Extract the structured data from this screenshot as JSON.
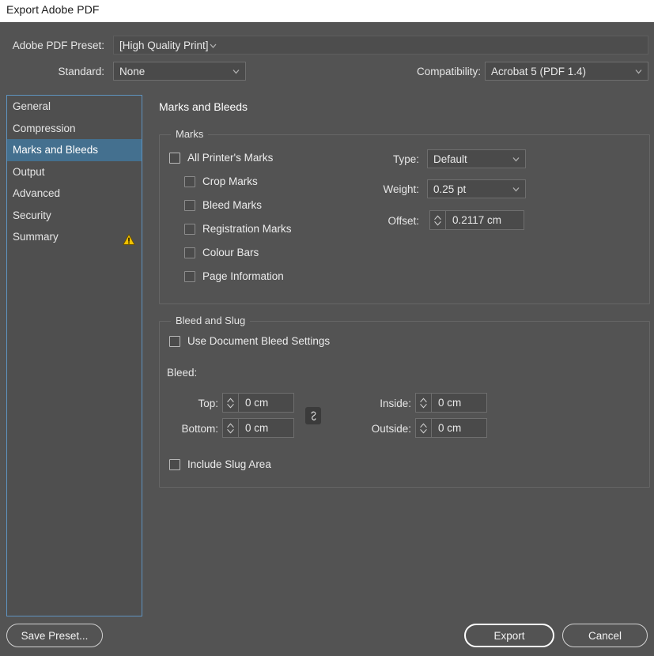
{
  "window": {
    "title": "Export Adobe PDF"
  },
  "top": {
    "preset_label": "Adobe PDF Preset:",
    "preset_value": "[High Quality Print]",
    "standard_label": "Standard:",
    "standard_value": "None",
    "compatibility_label": "Compatibility:",
    "compatibility_value": "Acrobat 5 (PDF 1.4)"
  },
  "sidebar": {
    "items": [
      {
        "label": "General",
        "selected": false,
        "warning": false
      },
      {
        "label": "Compression",
        "selected": false,
        "warning": false
      },
      {
        "label": "Marks and Bleeds",
        "selected": true,
        "warning": false
      },
      {
        "label": "Output",
        "selected": false,
        "warning": false
      },
      {
        "label": "Advanced",
        "selected": false,
        "warning": false
      },
      {
        "label": "Security",
        "selected": false,
        "warning": false
      },
      {
        "label": "Summary",
        "selected": false,
        "warning": true
      }
    ]
  },
  "main": {
    "panel_title": "Marks and Bleeds",
    "marks": {
      "group_label": "Marks",
      "all_printers_marks": {
        "label": "All Printer's Marks",
        "checked": false
      },
      "crop_marks": {
        "label": "Crop Marks",
        "checked": false
      },
      "bleed_marks": {
        "label": "Bleed Marks",
        "checked": false
      },
      "registration_marks": {
        "label": "Registration Marks",
        "checked": false
      },
      "colour_bars": {
        "label": "Colour Bars",
        "checked": false
      },
      "page_information": {
        "label": "Page Information",
        "checked": false
      },
      "type_label": "Type:",
      "type_value": "Default",
      "weight_label": "Weight:",
      "weight_value": "0.25 pt",
      "offset_label": "Offset:",
      "offset_value": "0.2117 cm"
    },
    "bleed_slug": {
      "group_label": "Bleed and Slug",
      "use_document_bleed": {
        "label": "Use Document Bleed Settings",
        "checked": false
      },
      "bleed_label": "Bleed:",
      "top_label": "Top:",
      "top_value": "0 cm",
      "bottom_label": "Bottom:",
      "bottom_value": "0 cm",
      "inside_label": "Inside:",
      "inside_value": "0 cm",
      "outside_label": "Outside:",
      "outside_value": "0 cm",
      "link_icon": "chain-link-icon",
      "include_slug": {
        "label": "Include Slug Area",
        "checked": false
      }
    }
  },
  "footer": {
    "save_preset": "Save Preset...",
    "export": "Export",
    "cancel": "Cancel"
  },
  "colors": {
    "dialog_bg": "#535353",
    "titlebar_bg": "#ffffff",
    "field_bg": "#4a4a4a",
    "selection": "#44708f",
    "focus_border": "#5f93bf",
    "warning": "#f2c200"
  }
}
